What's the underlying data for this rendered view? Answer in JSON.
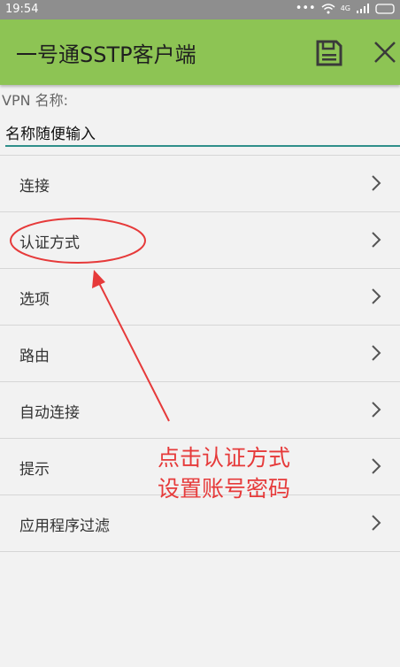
{
  "status_bar": {
    "time": "19:54",
    "network_label": "4G"
  },
  "app_bar": {
    "title": "一号通SSTP客户端"
  },
  "form": {
    "vpn_name_label": "VPN 名称:",
    "vpn_name_value": "名称随便输入"
  },
  "menu": {
    "items": [
      {
        "label": "连接"
      },
      {
        "label": "认证方式"
      },
      {
        "label": "选项"
      },
      {
        "label": "路由"
      },
      {
        "label": "自动连接"
      },
      {
        "label": "提示"
      },
      {
        "label": "应用程序过滤"
      }
    ]
  },
  "annotation": {
    "line1": "点击认证方式",
    "line2": "设置账号密码",
    "color": "#e63a3a"
  },
  "colors": {
    "app_bar": "#8dc454",
    "input_underline": "#2f8f8a"
  }
}
